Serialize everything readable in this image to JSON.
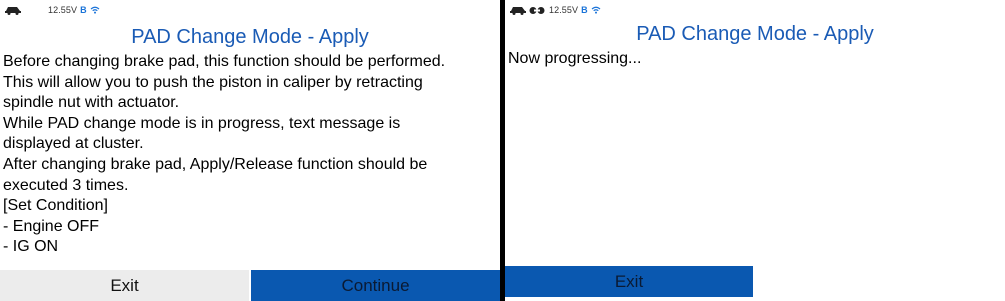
{
  "left_screen": {
    "status": {
      "voltage": "12.55V",
      "bluetooth_glyph": "B",
      "icons": [
        "car-icon",
        "bluetooth-icon",
        "wifi-icon"
      ]
    },
    "title": "PAD Change Mode - Apply",
    "lines": [
      "Before changing brake pad, this function should be performed.",
      "This will allow you to push the piston in caliper by retracting",
      "spindle nut with actuator.",
      "While PAD change mode is in progress, text message is",
      "displayed at cluster.",
      "After changing brake pad, Apply/Release function should be",
      "executed 3 times.",
      "[Set Condition]",
      "- Engine OFF",
      "- IG ON"
    ],
    "buttons": {
      "exit": "Exit",
      "continue": "Continue"
    }
  },
  "right_screen": {
    "status": {
      "voltage": "12.55V",
      "bluetooth_glyph": "B",
      "icons": [
        "car-icon",
        "link-icon",
        "bluetooth-icon",
        "wifi-icon"
      ]
    },
    "title": "PAD Change Mode - Apply",
    "message": "Now progressing...",
    "buttons": {
      "exit": "Exit"
    }
  },
  "colors": {
    "title": "#1a5bb5",
    "button_blue": "#0a58b0",
    "button_grey": "#ececec",
    "divider": "#000000",
    "bluetooth": "#1a73d8"
  }
}
